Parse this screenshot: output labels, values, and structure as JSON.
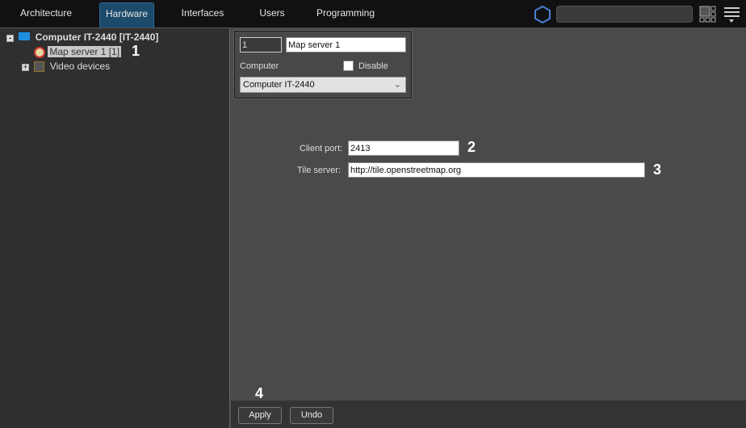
{
  "tabs": [
    "Architecture",
    "Hardware",
    "Interfaces",
    "Users",
    "Programming"
  ],
  "tree": {
    "root": "Computer IT-2440 [IT-2440]",
    "child1": "Map server 1 [1]",
    "child2": "Video devices"
  },
  "form": {
    "id": "1",
    "name": "Map server 1",
    "computer_label": "Computer",
    "disable_label": "Disable",
    "computer_value": "Computer IT-2440",
    "client_port_label": "Client port:",
    "client_port": "2413",
    "tile_server_label": "Tile server:",
    "tile_server": "http://tile.openstreetmap.org"
  },
  "callouts": [
    "1",
    "2",
    "3",
    "4"
  ],
  "buttons": {
    "apply": "Apply",
    "undo": "Undo"
  },
  "colors": {
    "accent": "#1b4a6b",
    "hex": "#4a7fd4"
  }
}
